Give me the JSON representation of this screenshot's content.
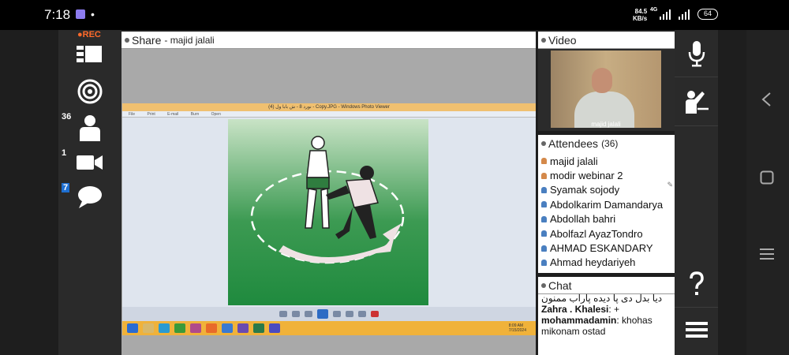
{
  "status_bar": {
    "time": "7:18",
    "dot": "•",
    "speed_value": "84.5",
    "speed_unit": "KB/s",
    "network": "4G",
    "battery": "64"
  },
  "left_bar": {
    "rec_label": "●REC",
    "attendee_badge": "36",
    "camera_badge": "1",
    "chat_badge": "7"
  },
  "share_pod": {
    "title": "Share",
    "presenter": "- majid jalali",
    "window_title": "(4) نورد 8 - ش بابا ول - Copy.JPG - Windows Photo Viewer",
    "window_menu": [
      "File",
      "Print",
      "E-mail",
      "Burn",
      "Open"
    ],
    "taskbar_clock": [
      "8:09 AM",
      "7/15/2024"
    ]
  },
  "video_pod": {
    "title": "Video",
    "camera_label": "majid jalali"
  },
  "attendees_pod": {
    "title": "Attendees",
    "count": "(36)",
    "items": [
      {
        "name": "majid jalali",
        "role": "host"
      },
      {
        "name": "modir webinar 2",
        "role": "host"
      },
      {
        "name": "Syamak sojody",
        "role": "participant"
      },
      {
        "name": "Abdolkarim Damandarya",
        "role": "participant"
      },
      {
        "name": "Abdollah bahri",
        "role": "participant"
      },
      {
        "name": "Abolfazl AyazTondro",
        "role": "participant"
      },
      {
        "name": "AHMAD ESKANDARY",
        "role": "participant"
      },
      {
        "name": "Ahmad heydariyeh",
        "role": "participant"
      }
    ]
  },
  "chat_pod": {
    "title": "Chat",
    "messages": [
      {
        "sender": "",
        "text": "دیا بدل دی پا دیده پاراب ممنون"
      },
      {
        "sender": "Zahra . Khalesi",
        "text": ": +"
      },
      {
        "sender": "mohammadamin",
        "text": ": khohas mikonam ostad"
      }
    ]
  },
  "colors": {
    "accent_orange": "#ff6a2a",
    "badge_blue": "#1e6fd1",
    "host_icon": "#d4894a",
    "participant_icon": "#4a7fc0"
  }
}
